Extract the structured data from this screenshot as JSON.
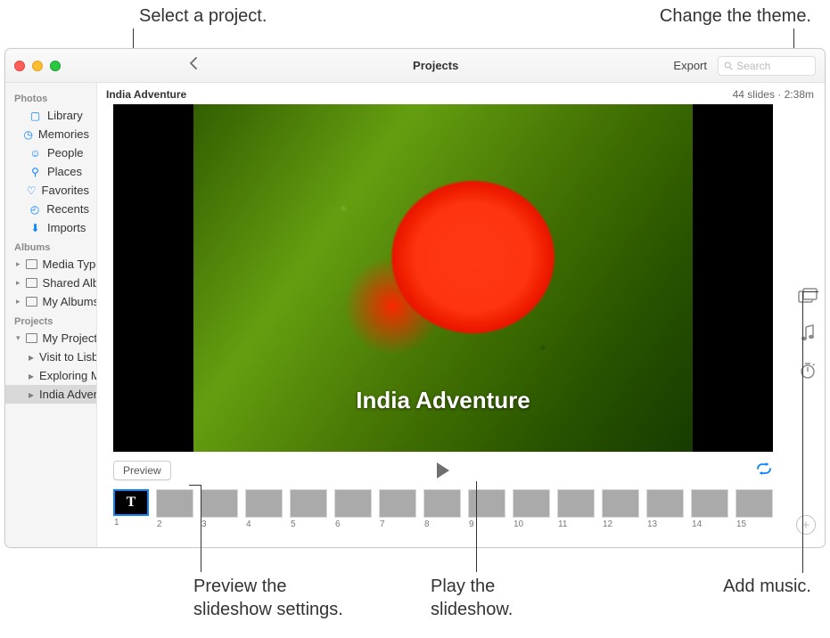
{
  "callouts": {
    "select_project": "Select a project.",
    "change_theme": "Change the theme.",
    "preview_settings": "Preview the\nslideshow settings.",
    "play_slideshow": "Play the\nslideshow.",
    "add_music": "Add music."
  },
  "titlebar": {
    "title": "Projects",
    "export": "Export",
    "search_placeholder": "Search"
  },
  "sidebar": {
    "sections": {
      "photos": "Photos",
      "albums": "Albums",
      "projects": "Projects"
    },
    "photos_items": {
      "library": "Library",
      "memories": "Memories",
      "people": "People",
      "places": "Places",
      "favorites": "Favorites",
      "recents": "Recents",
      "imports": "Imports"
    },
    "albums_items": {
      "media_types": "Media Types",
      "shared_albums": "Shared Albums",
      "my_albums": "My Albums"
    },
    "projects_items": {
      "my_projects": "My Projects",
      "visit_to_lisbon": "Visit to Lisbon",
      "exploring_mor": "Exploring Mor…",
      "india_adventure": "India Adventure"
    }
  },
  "main": {
    "project_title": "India Adventure",
    "meta": "44 slides · 2:38m",
    "overlay_title": "India Adventure",
    "preview_btn": "Preview",
    "first_thumb_letter": "T"
  },
  "thumbs": [
    {
      "n": "1"
    },
    {
      "n": "2"
    },
    {
      "n": "3"
    },
    {
      "n": "4"
    },
    {
      "n": "5"
    },
    {
      "n": "6"
    },
    {
      "n": "7"
    },
    {
      "n": "8"
    },
    {
      "n": "9"
    },
    {
      "n": "10"
    },
    {
      "n": "11"
    },
    {
      "n": "12"
    },
    {
      "n": "13"
    },
    {
      "n": "14"
    },
    {
      "n": "15"
    }
  ]
}
